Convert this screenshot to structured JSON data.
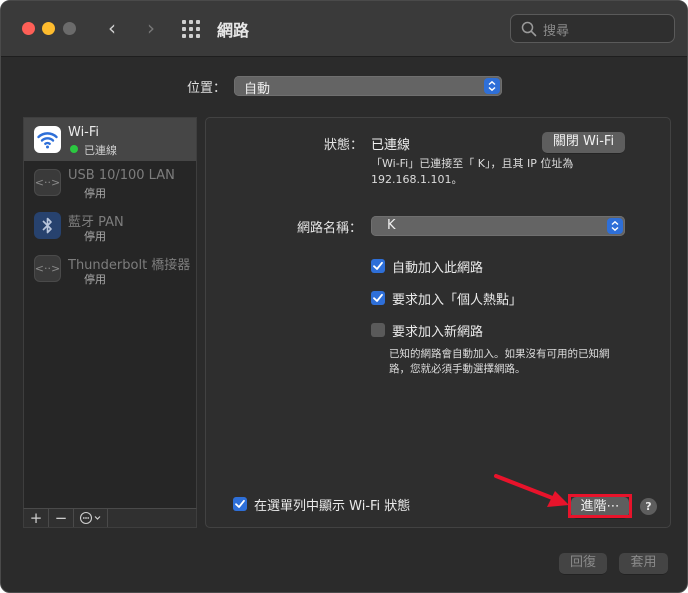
{
  "window": {
    "title": "網路",
    "search_placeholder": "搜尋"
  },
  "location": {
    "label": "位置：",
    "value": "自動"
  },
  "sidebar": {
    "services": [
      {
        "name": "Wi-Fi",
        "status": "已連線",
        "selected": true
      },
      {
        "name": "USB 10/100 LAN",
        "status": "停用",
        "selected": false
      },
      {
        "name": "藍牙 PAN",
        "status": "停用",
        "selected": false
      },
      {
        "name": "Thunderbolt 橋接器",
        "status": "停用",
        "selected": false
      }
    ],
    "tools": {
      "add": "+",
      "remove": "−"
    }
  },
  "detail": {
    "status_label": "狀態：",
    "status_value": "已連線",
    "wifi_off_button": "關閉 Wi-Fi",
    "status_desc_line1": "「Wi-Fi」已連接至「 K」，且其 IP 位址為",
    "status_desc_line2": "192.168.1.101。",
    "network_name_label": "網路名稱：",
    "network_name_value": "K",
    "auto_join_label": "自動加入此網路",
    "auto_join_checked": true,
    "ask_hotspot_label": "要求加入「個人熱點」",
    "ask_hotspot_checked": true,
    "ask_new_label": "要求加入新網路",
    "ask_new_checked": false,
    "hint_line1": "已知的網路會自動加入。如果沒有可用的已知網",
    "hint_line2": "路，您就必須手動選擇網路。",
    "show_menubar_label": "在選單列中顯示 Wi-Fi 狀態",
    "show_menubar_checked": true,
    "advanced_button": "進階⋯",
    "help_button": "?"
  },
  "footer": {
    "revert_button": "回復",
    "apply_button": "套用"
  },
  "colors": {
    "accent": "#2e6fd8",
    "connected": "#2bc840",
    "annotation": "#e8132b"
  }
}
